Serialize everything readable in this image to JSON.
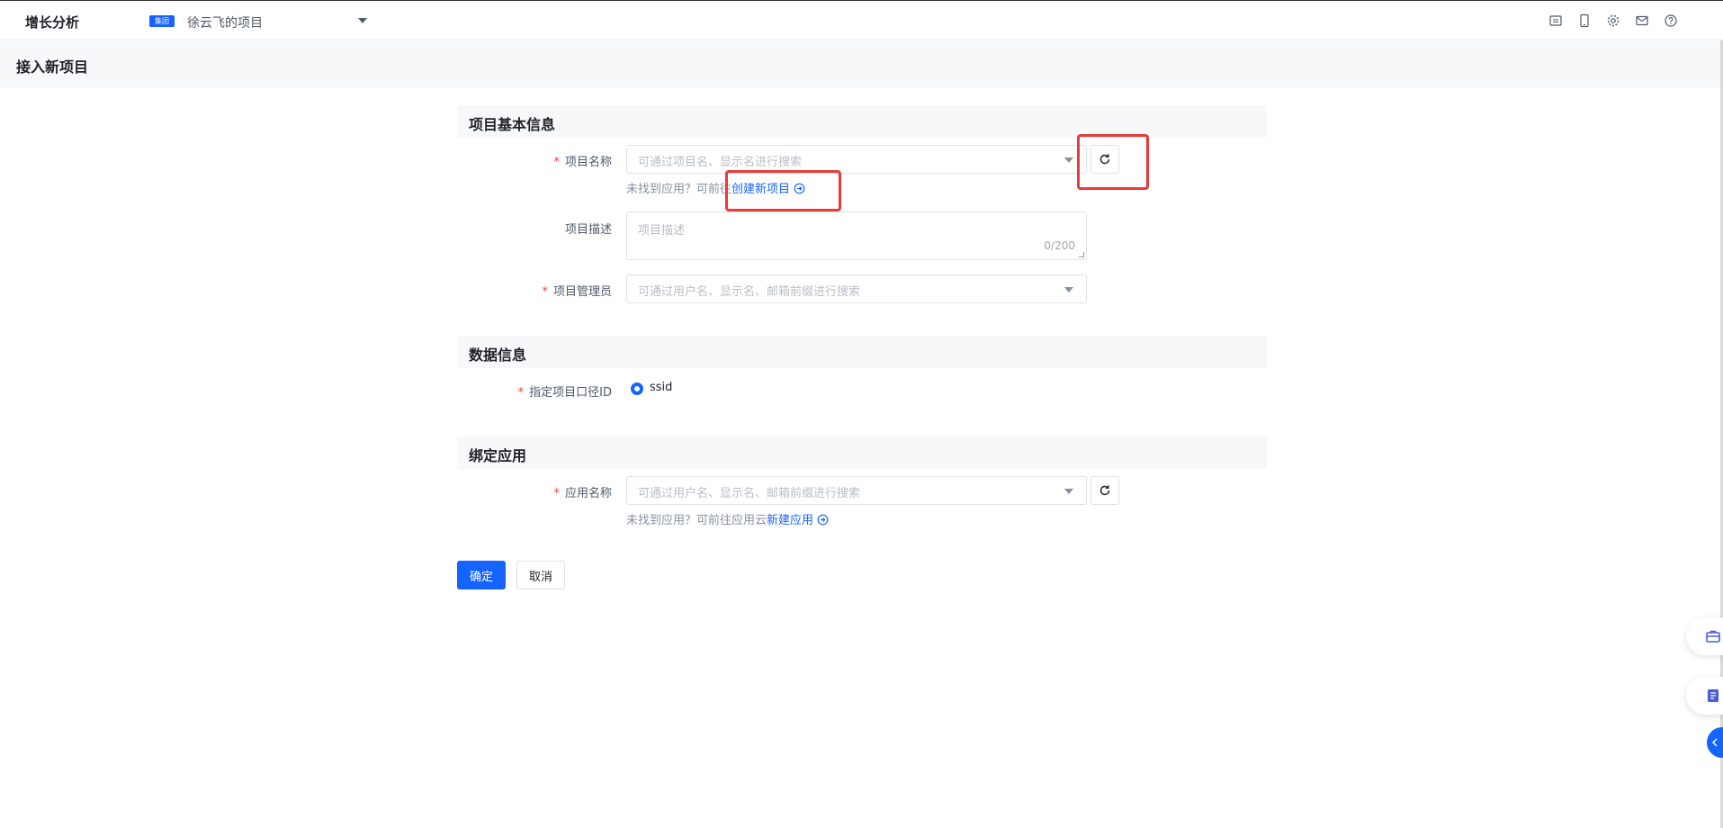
{
  "topbar": {
    "app_title": "增长分析",
    "group_tag": "集团",
    "project_name": "徐云飞的项目",
    "icons": [
      "switch-icon",
      "mobile-icon",
      "gear-icon",
      "mail-icon",
      "help-icon"
    ]
  },
  "page": {
    "title": "接入新项目"
  },
  "basic_info": {
    "heading": "项目基本信息",
    "project_name_label": "项目名称",
    "project_name_placeholder": "可通过项目名、显示名进行搜索",
    "hint_prefix": "未找到应用？可前往",
    "create_link": "创建新项目",
    "description_label": "项目描述",
    "description_placeholder": "项目描述",
    "description_count": "0/200",
    "admin_label": "项目管理员",
    "admin_placeholder": "可通过用户名、显示名、邮箱前缀进行搜索"
  },
  "data_info": {
    "heading": "数据信息",
    "id_label": "指定项目口径ID",
    "id_option": "ssid"
  },
  "bind_app": {
    "heading": "绑定应用",
    "app_label": "应用名称",
    "app_placeholder": "可通过用户名、显示名、邮箱前缀进行搜索",
    "hint_prefix": "未找到应用？可前往应用云",
    "create_link": "新建应用"
  },
  "actions": {
    "ok": "确定",
    "cancel": "取消"
  },
  "colors": {
    "primary": "#1664ff",
    "required": "#f53f3f",
    "highlight": "#e83a3a"
  }
}
